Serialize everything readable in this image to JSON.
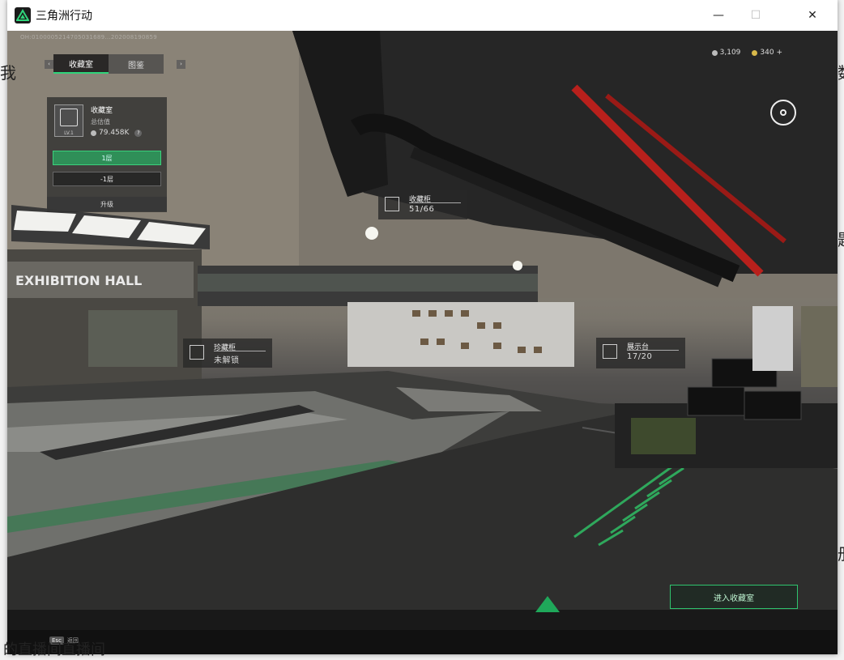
{
  "window": {
    "title": "三角洲行动"
  },
  "hud": {
    "build_id": "OH:0100005214705031689...202008190859",
    "tabs": [
      {
        "label": "收藏室",
        "active": true
      },
      {
        "label": "图鉴",
        "active": false
      }
    ],
    "panel": {
      "title": "收藏室",
      "subtitle": "总估值",
      "value": "79.458K",
      "level": "LV.1",
      "floors": [
        "1层",
        "-1层"
      ],
      "upgrade": "升级"
    },
    "currency": {
      "silver": "3,109",
      "gold": "340 +"
    },
    "labels": {
      "cabinet": {
        "title": "收藏柜",
        "value": "51/66"
      },
      "rare": {
        "title": "珍藏柜",
        "value": "未解锁"
      },
      "display": {
        "title": "展示台",
        "value": "17/20"
      }
    },
    "enter_button": "进入收藏室",
    "esc": {
      "key": "Esc",
      "label": "返回"
    }
  },
  "scene": {
    "sign": "EXHIBITION HALL"
  },
  "background": {
    "fragments": [
      "我",
      "数",
      "题",
      "册",
      "的直播间直播间"
    ]
  },
  "colors": {
    "accent": "#2fd47a",
    "pipe_red": "#b8201c"
  }
}
